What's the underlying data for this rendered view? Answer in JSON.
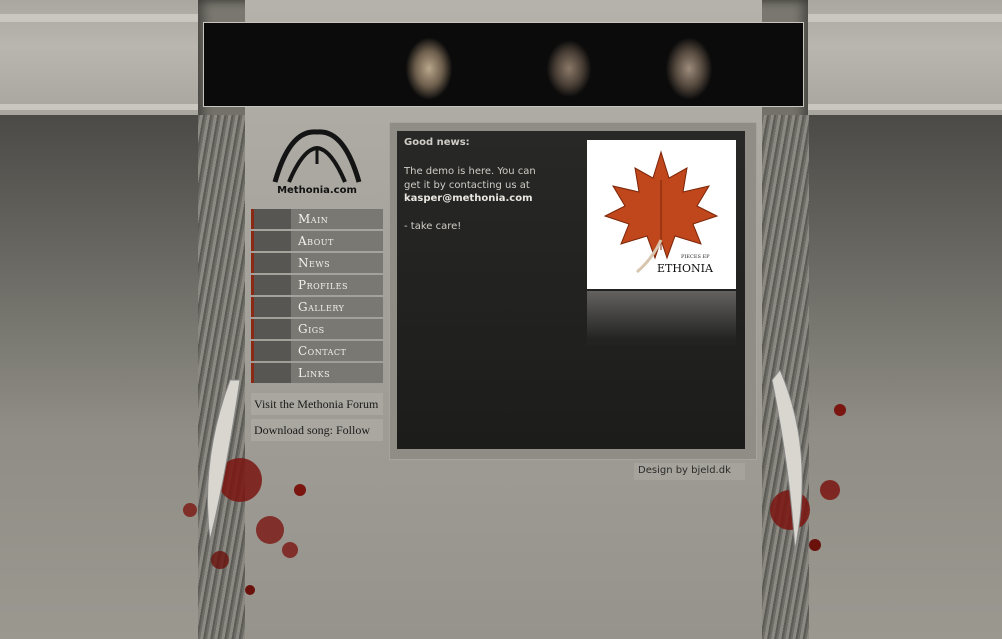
{
  "header": {
    "banner_alt": "band members photo banner"
  },
  "logo": {
    "text": "Methonia.com"
  },
  "nav": {
    "items": [
      {
        "label": "Main"
      },
      {
        "label": "About"
      },
      {
        "label": "News"
      },
      {
        "label": "Profiles"
      },
      {
        "label": "Gallery"
      },
      {
        "label": "Gigs"
      },
      {
        "label": "Contact"
      },
      {
        "label": "Links"
      }
    ]
  },
  "side_links": {
    "forum": "Visit the Methonia Forum",
    "download": "Download song: Follow"
  },
  "content": {
    "heading": "Good news:",
    "body_line1": "The demo is here. You can",
    "body_line2": "get it by contacting us at",
    "email": "kasper@methonia.com",
    "signoff": "- take care!",
    "cover_small_text": "PIECES EP",
    "cover_band": "ETHONIA"
  },
  "footer": {
    "credit": "Design by bjeld.dk"
  },
  "colors": {
    "accent_red": "#8a2a14",
    "content_bg": "#1f1f1e",
    "nav_text": "#f4f2ea",
    "leaf": "#c0461c"
  },
  "icons": [
    "methonia-logo-icon",
    "maple-leaf-icon"
  ]
}
